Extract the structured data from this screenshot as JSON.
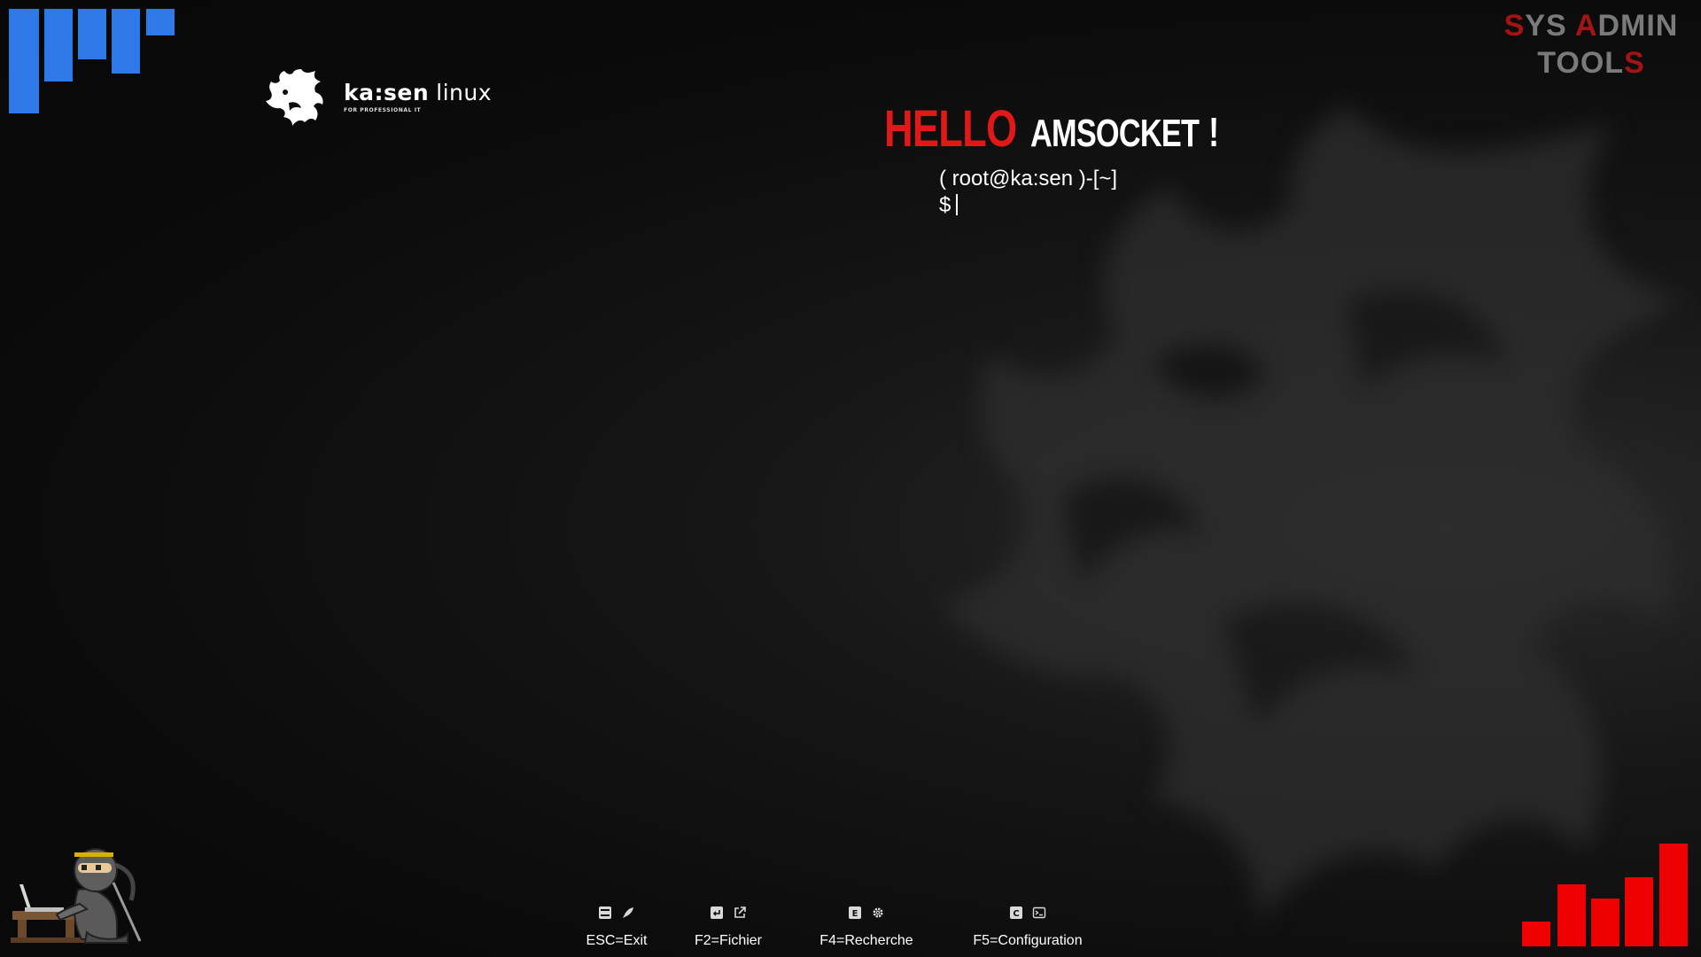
{
  "brand": {
    "name": "ka:sen",
    "suffix": "linux",
    "tagline": "FOR PROFESSIONAL IT"
  },
  "corner_title": {
    "line1_a_red": "S",
    "line1_a_rest": "YS",
    "line1_b_red": "A",
    "line1_b_rest": "DMIN",
    "line2_rest": "TOOL",
    "line2_red": "S"
  },
  "greeting": {
    "hello": "HELLO",
    "name": "AMSOCKET",
    "exclamation": "!"
  },
  "prompt": {
    "context": "( root@ka:sen )-[~]",
    "symbol": "$"
  },
  "fkeys": [
    {
      "label": "ESC=Exit",
      "icons": [
        "toggle-icon",
        "rocket-icon"
      ]
    },
    {
      "label": "F2=Fichier",
      "icons": [
        "back-icon",
        "open-external-icon"
      ]
    },
    {
      "label": "F4=Recherche",
      "icons": [
        "e-key-icon",
        "gear-icon"
      ]
    },
    {
      "label": "F5=Configuration",
      "icons": [
        "c-key-icon",
        "terminal-icon"
      ]
    }
  ],
  "colors": {
    "accent_blue": "#2f78e8",
    "accent_red": "#ee0000",
    "hello_red": "#e01818",
    "title_grey": "#7a7a7a"
  }
}
